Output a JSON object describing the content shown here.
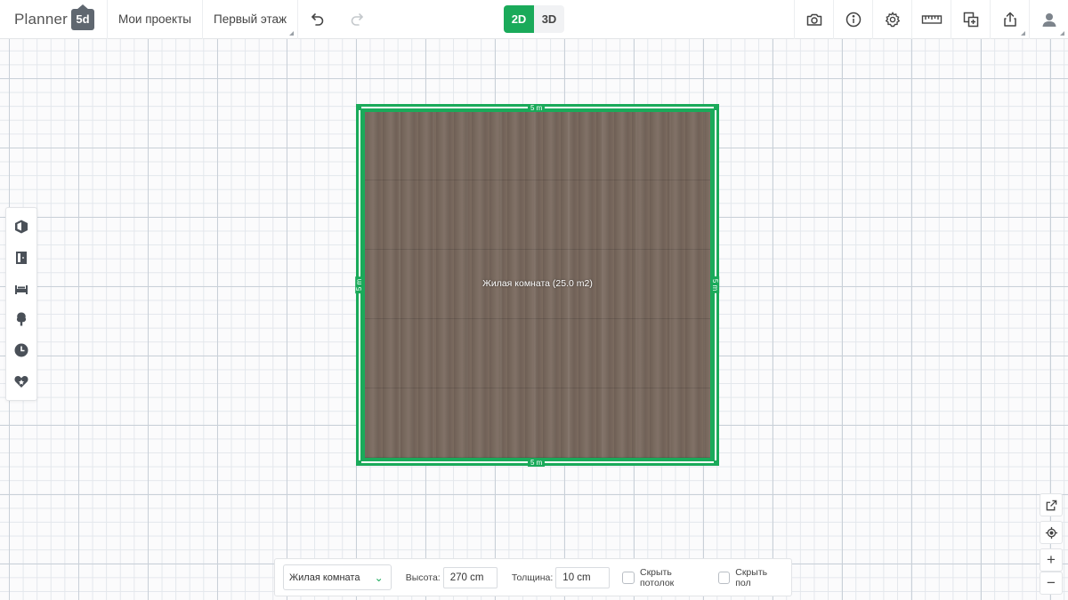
{
  "header": {
    "logo_text": "Planner",
    "logo_badge": "5d",
    "projects_label": "Мои проекты",
    "floor_label": "Первый этаж",
    "mode_2d": "2D",
    "mode_3d": "3D"
  },
  "left_tools": [
    {
      "icon": "structure-icon"
    },
    {
      "icon": "door-icon"
    },
    {
      "icon": "bed-icon"
    },
    {
      "icon": "tree-icon"
    },
    {
      "icon": "history-icon"
    },
    {
      "icon": "favorites-icon"
    }
  ],
  "room": {
    "label": "Жилая комната (25.0 m2)",
    "dim_top": "5 m",
    "dim_bottom": "5 m",
    "dim_left": "5 m",
    "dim_right": "5 m",
    "wall_color": "#1aaa5a",
    "floor_texture": "wood"
  },
  "props": {
    "room_type": "Жилая комната",
    "height_label": "Высота:",
    "height_value": "270 cm",
    "thickness_label": "Толщина:",
    "thickness_value": "10 cm",
    "hide_ceiling_label": "Скрыть потолок",
    "hide_floor_label": "Скрыть пол"
  },
  "right_controls": {
    "zoom_in": "+",
    "zoom_out": "−"
  },
  "colors": {
    "accent": "#1aaa5a"
  }
}
